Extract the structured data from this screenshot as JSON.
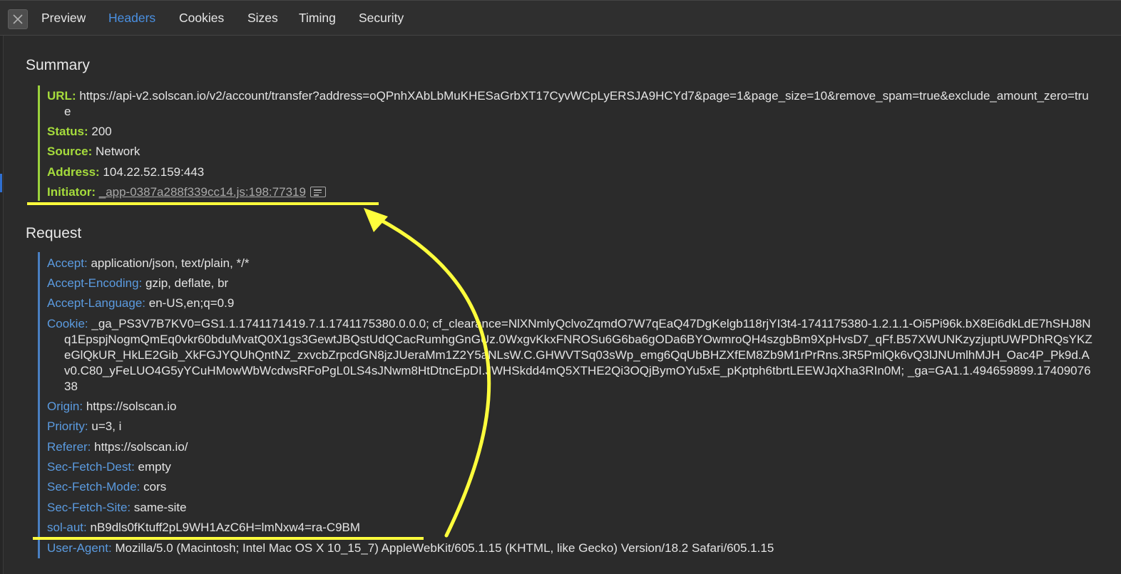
{
  "tabs": [
    {
      "label": "Preview",
      "active": false
    },
    {
      "label": "Headers",
      "active": true
    },
    {
      "label": "Cookies",
      "active": false
    },
    {
      "label": "Sizes",
      "active": false
    },
    {
      "label": "Timing",
      "active": false
    },
    {
      "label": "Security",
      "active": false
    }
  ],
  "summary": {
    "title": "Summary",
    "url_key": "URL:",
    "url_value": "https://api-v2.solscan.io/v2/account/transfer?address=oQPnhXAbLbMuKHESaGrbXT17CyvWCpLyERSJA9HCYd7&page=1&page_size=10&remove_spam=true&exclude_amount_zero=true",
    "status_key": "Status:",
    "status_value": "200",
    "source_key": "Source:",
    "source_value": "Network",
    "address_key": "Address:",
    "address_value": "104.22.52.159:443",
    "initiator_key": "Initiator:",
    "initiator_value": "_app-0387a288f339cc14.js:198:77319"
  },
  "request": {
    "title": "Request",
    "headers": [
      {
        "key": "Accept:",
        "value": "application/json, text/plain, */*"
      },
      {
        "key": "Accept-Encoding:",
        "value": "gzip, deflate, br"
      },
      {
        "key": "Accept-Language:",
        "value": "en-US,en;q=0.9"
      },
      {
        "key": "Cookie:",
        "value": "_ga_PS3V7B7KV0=GS1.1.1741171419.7.1.1741175380.0.0.0; cf_clearance=NlXNmlyQclvoZqmdO7W7qEaQ47DgKelgb118rjYI3t4-1741175380-1.2.1.1-Oi5Pi96k.bX8Ei6dkLdE7hSHJ8Nq1EpspjNogmQmEq0vkr60bduMvatQ0X1gs3GewtJBQstUdQCacRumhgGnGUz.0WxgvKkxFNROSu6G6ba6gODa6BYOwmroQH4szgbBm9XpHvsD7_qFf.B57XWUNKzyzjuptUWPDhRQsYKZeGlQkUR_HkLE2Gib_XkFGJYQUhQntNZ_zxvcbZrpcdGN8jzJUeraMm1Z2Y5aNLsW.C.GHWVTSq03sWp_emg6QqUbBHZXfEM8Zb9M1rPrRns.3R5PmlQk6vQ3lJNUmlhMJH_Oac4P_Pk9d.Av0.C80_yFeLUO4G5yYCuHMowWbWcdwsRFoPgL0LS4sJNwm8HtDtncEpDI.JWHSkdd4mQ5XTHE2Qi3OQjBymOYu5xE_pKptph6tbrtLEEWJqXha3RIn0M; _ga=GA1.1.494659899.1740907638"
      },
      {
        "key": "Origin:",
        "value": "https://solscan.io"
      },
      {
        "key": "Priority:",
        "value": "u=3, i"
      },
      {
        "key": "Referer:",
        "value": "https://solscan.io/"
      },
      {
        "key": "Sec-Fetch-Dest:",
        "value": "empty"
      },
      {
        "key": "Sec-Fetch-Mode:",
        "value": "cors"
      },
      {
        "key": "Sec-Fetch-Site:",
        "value": "same-site"
      },
      {
        "key": "sol-aut:",
        "value": "nB9dls0fKtuff2pL9WH1AzC6H=lmNxw4=ra-C9BM"
      },
      {
        "key": "User-Agent:",
        "value": "Mozilla/5.0 (Macintosh; Intel Mac OS X 10_15_7) AppleWebKit/605.1.15 (KHTML, like Gecko) Version/18.2 Safari/605.1.15"
      }
    ]
  },
  "colors": {
    "background": "#2b2b2b",
    "active_tab": "#4a90e2",
    "summary_key": "#a6dc3c",
    "request_key": "#5b9be0",
    "annotation": "#ffff3c"
  },
  "icons": {
    "close": "close-x-icon",
    "initiator_link": "source-reveal-icon"
  }
}
